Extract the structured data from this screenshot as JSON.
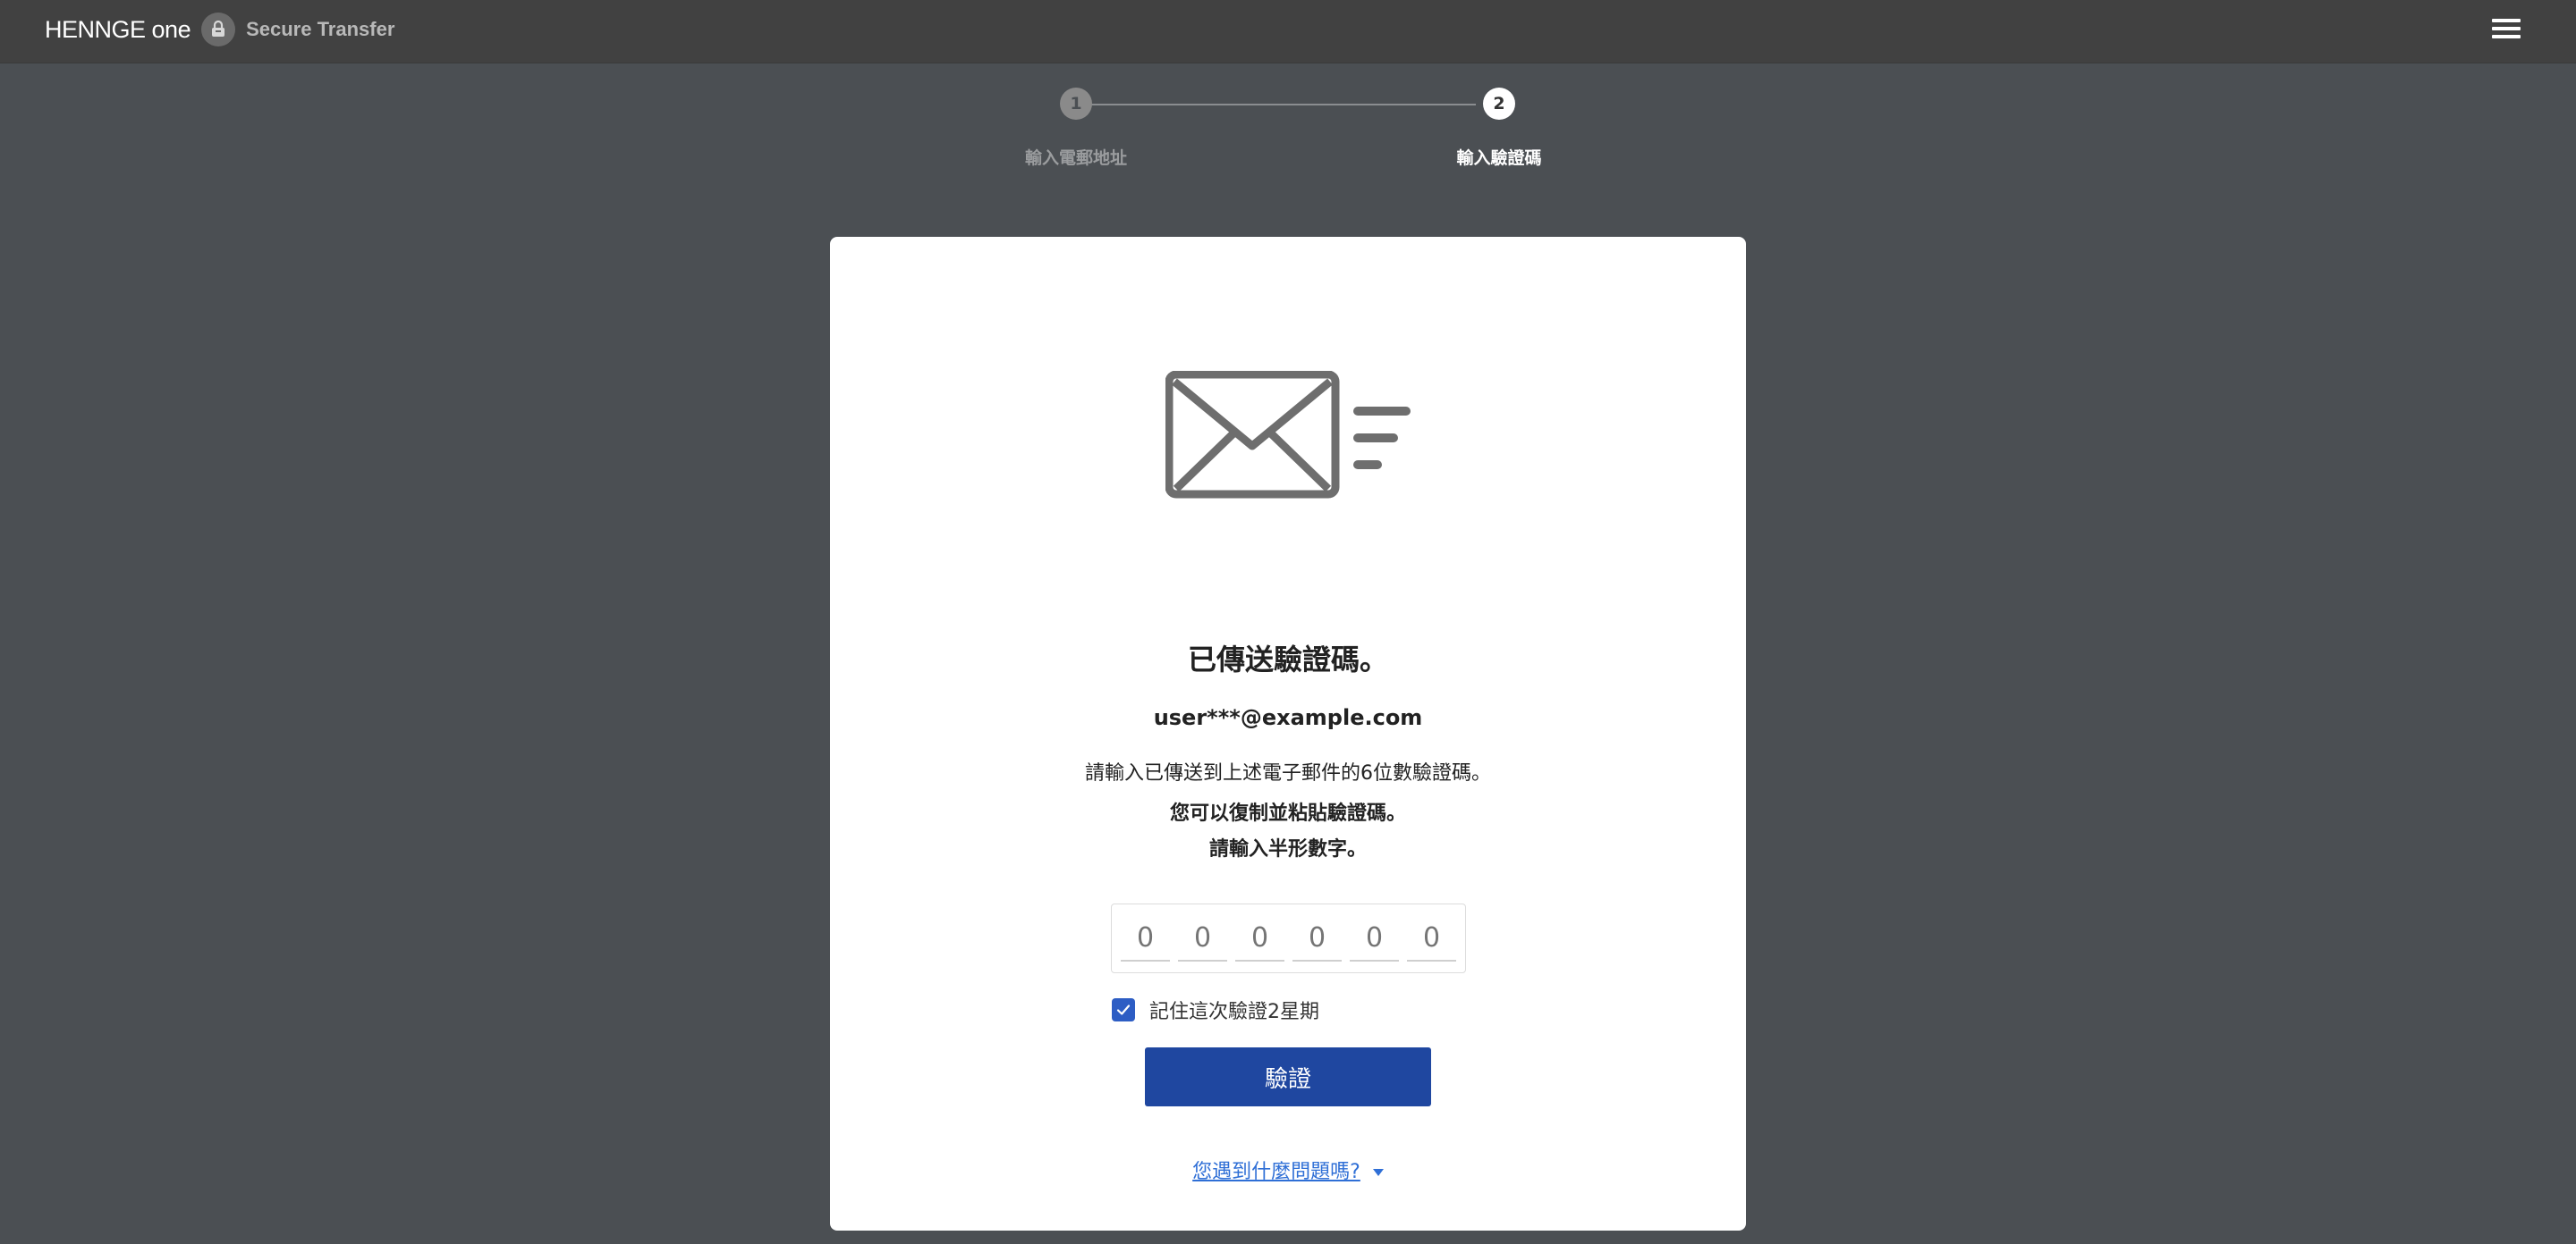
{
  "header": {
    "brand_main": "HENNGE",
    "brand_one": "one",
    "product": "Secure Transfer"
  },
  "stepper": {
    "steps": [
      {
        "number": "1",
        "label": "輸入電郵地址",
        "active": false
      },
      {
        "number": "2",
        "label": "輸入驗證碼",
        "active": true
      }
    ]
  },
  "card": {
    "title": "已傳送驗證碼。",
    "email": "user***@example.com",
    "instruction": "請輸入已傳送到上述電子郵件的6位數驗證碼。",
    "hint_line1": "您可以復制並粘貼驗證碼。",
    "hint_line2": "請輸入半形數字。",
    "code_placeholder": "0",
    "remember_label": "記住這次驗證2星期",
    "remember_checked": true,
    "verify_label": "驗證",
    "help_label": "您遇到什麼問題嗎?"
  },
  "colors": {
    "background": "#4b4f53",
    "topbar": "#414141",
    "primary_button": "#1f47a0",
    "checkbox": "#2d5dc4",
    "link": "#2f6fd6"
  },
  "icons": {
    "menu": "hamburger-icon",
    "mail": "envelope-sent-icon",
    "badge": "lock-icon"
  }
}
